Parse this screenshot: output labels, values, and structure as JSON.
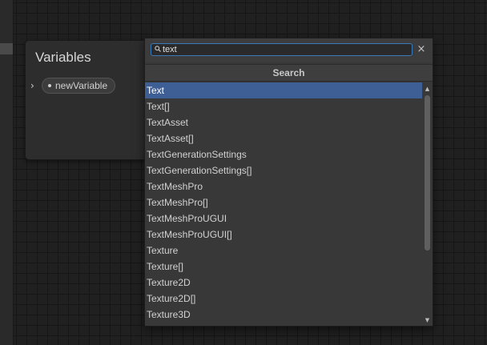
{
  "variables_panel": {
    "title": "Variables",
    "variable_name": "newVariable"
  },
  "search_window": {
    "query": "text",
    "header": "Search",
    "clear_icon": "×",
    "items": [
      "Text",
      "Text[]",
      "TextAsset",
      "TextAsset[]",
      "TextGenerationSettings",
      "TextGenerationSettings[]",
      "TextMeshPro",
      "TextMeshPro[]",
      "TextMeshProUGUI",
      "TextMeshProUGUI[]",
      "Texture",
      "Texture[]",
      "Texture2D",
      "Texture2D[]",
      "Texture3D"
    ],
    "selected_index": 0
  },
  "colors": {
    "selection": "#3e5f96",
    "focus_border": "#3a79bb",
    "grid_background": "#202020"
  }
}
